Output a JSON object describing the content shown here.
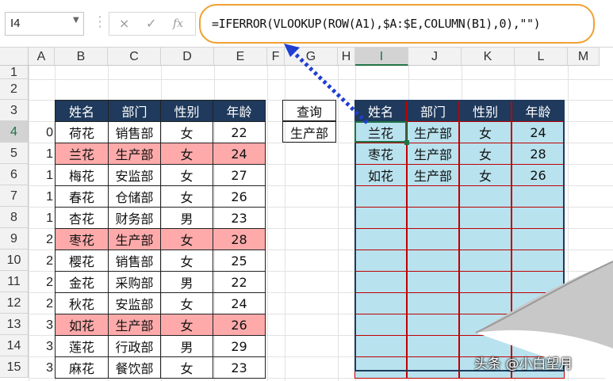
{
  "name_box": "I4",
  "formula_icons": {
    "cancel": "×",
    "enter": "✓",
    "fx": "fx"
  },
  "formula": "=IFERROR(VLOOKUP(ROW(A1),$A:$E,COLUMN(B1),0),\"\")",
  "columns": [
    "A",
    "B",
    "C",
    "D",
    "E",
    "F",
    "G",
    "H",
    "I",
    "J",
    "K",
    "L",
    "M"
  ],
  "rows": [
    "1",
    "2",
    "3",
    "4",
    "5",
    "6",
    "7",
    "8",
    "9",
    "10",
    "11",
    "12",
    "13",
    "14",
    "15"
  ],
  "source_table": {
    "headers": [
      "姓名",
      "部门",
      "性别",
      "年龄"
    ],
    "rows": [
      {
        "a": "0",
        "name": "荷花",
        "dept": "销售部",
        "sex": "女",
        "age": "22",
        "hl": false
      },
      {
        "a": "1",
        "name": "兰花",
        "dept": "生产部",
        "sex": "女",
        "age": "24",
        "hl": true
      },
      {
        "a": "1",
        "name": "梅花",
        "dept": "安监部",
        "sex": "女",
        "age": "27",
        "hl": false
      },
      {
        "a": "1",
        "name": "春花",
        "dept": "仓储部",
        "sex": "女",
        "age": "26",
        "hl": false
      },
      {
        "a": "1",
        "name": "杏花",
        "dept": "财务部",
        "sex": "男",
        "age": "23",
        "hl": false
      },
      {
        "a": "2",
        "name": "枣花",
        "dept": "生产部",
        "sex": "女",
        "age": "28",
        "hl": true
      },
      {
        "a": "2",
        "name": "樱花",
        "dept": "销售部",
        "sex": "女",
        "age": "25",
        "hl": false
      },
      {
        "a": "2",
        "name": "金花",
        "dept": "采购部",
        "sex": "男",
        "age": "22",
        "hl": false
      },
      {
        "a": "2",
        "name": "秋花",
        "dept": "安监部",
        "sex": "女",
        "age": "24",
        "hl": false
      },
      {
        "a": "3",
        "name": "如花",
        "dept": "生产部",
        "sex": "女",
        "age": "26",
        "hl": true
      },
      {
        "a": "3",
        "name": "莲花",
        "dept": "行政部",
        "sex": "男",
        "age": "29",
        "hl": false
      },
      {
        "a": "3",
        "name": "麻花",
        "dept": "餐饮部",
        "sex": "女",
        "age": "23",
        "hl": false
      }
    ]
  },
  "query": {
    "label": "查询",
    "value": "生产部"
  },
  "result_table": {
    "headers": [
      "姓名",
      "部门",
      "性别",
      "年龄"
    ],
    "rows": [
      [
        "兰花",
        "生产部",
        "女",
        "24"
      ],
      [
        "枣花",
        "生产部",
        "女",
        "28"
      ],
      [
        "如花",
        "生产部",
        "女",
        "26"
      ],
      [
        "",
        "",
        "",
        ""
      ],
      [
        "",
        "",
        "",
        ""
      ],
      [
        "",
        "",
        "",
        ""
      ],
      [
        "",
        "",
        "",
        ""
      ],
      [
        "",
        "",
        "",
        ""
      ],
      [
        "",
        "",
        "",
        ""
      ],
      [
        "",
        "",
        "",
        ""
      ],
      [
        "",
        "",
        "",
        ""
      ],
      [
        "",
        "",
        "",
        ""
      ]
    ]
  },
  "watermark": "头条 @小白望月",
  "colors": {
    "header_bg": "#1f3a5c",
    "highlight": "#ffaaaa",
    "result_bg": "#b8e2ee",
    "result_border": "#c00000",
    "formula_outline": "#f0a030",
    "arrow": "#1f3fd0"
  }
}
